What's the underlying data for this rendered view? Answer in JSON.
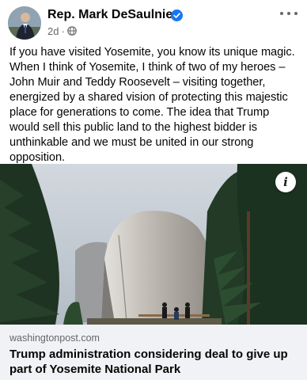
{
  "post": {
    "author": "Rep. Mark DeSaulnier",
    "timestamp": "2d",
    "separator": "·",
    "text": "If you have visited Yosemite, you know its unique magic. When I think of Yosemite, I think of two of my heroes – John Muir and Teddy Roosevelt – visiting together, energized by a shared vision of protecting this majestic place for generations to come. The idea that Trump would sell this public land to the highest bidder is unthinkable and we must be united in our strong opposition."
  },
  "link_preview": {
    "domain": "washingtonpost.com",
    "title": "Trump administration considering deal to give up part of Yosemite National Park",
    "info_glyph": "i"
  },
  "icons": {
    "verified": "verified-badge-icon",
    "audience": "globe-icon",
    "more": "more-options-icon",
    "info": "info-icon"
  },
  "colors": {
    "verified_blue": "#1877f2",
    "secondary_text": "#65676b",
    "link_footer_bg": "#f0f2f5"
  }
}
